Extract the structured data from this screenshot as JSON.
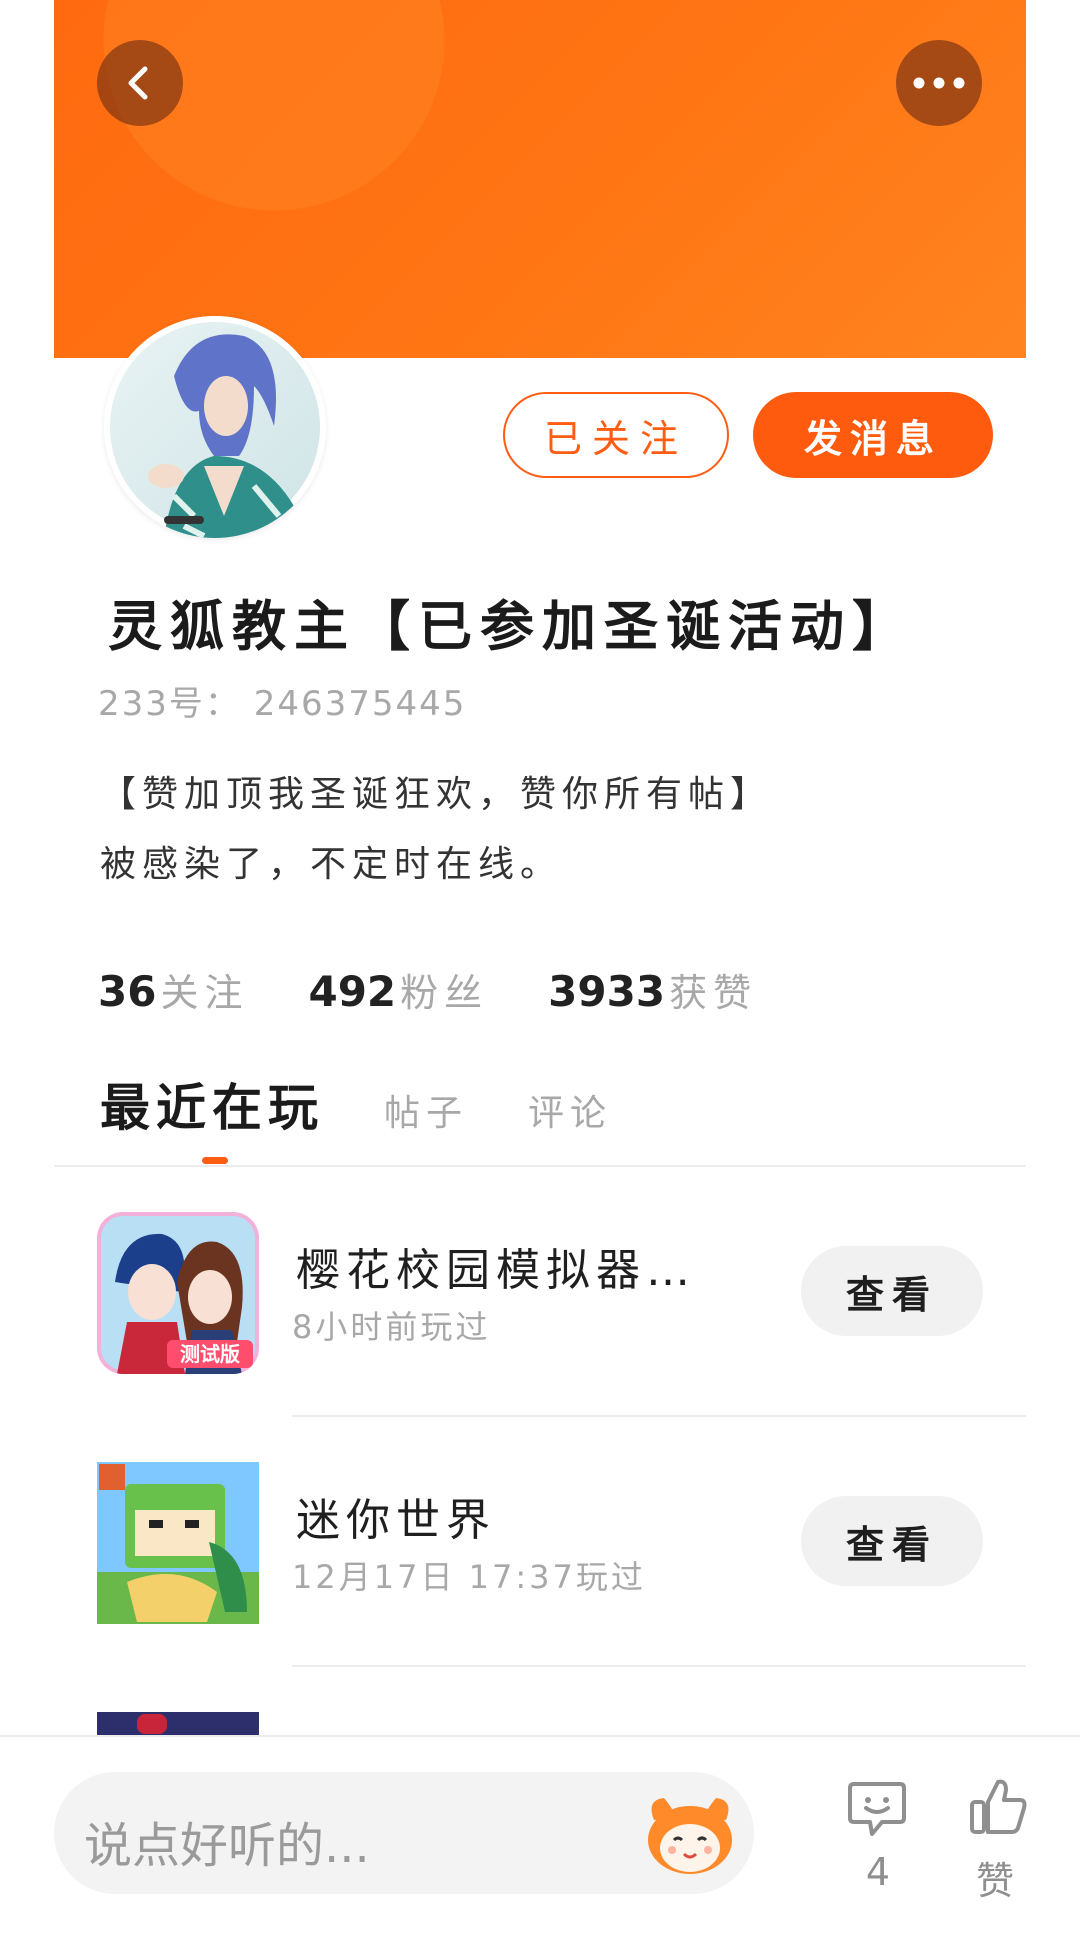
{
  "header": {
    "back_icon": "chevron-left-icon",
    "more_icon": "more-dots-icon",
    "accent": "#ff6a10"
  },
  "profile": {
    "follow_label": "已关注",
    "message_label": "发消息",
    "name": "灵狐教主【已参加圣诞活动】",
    "uid": "233号： 246375445",
    "bio": [
      "【赞加顶我圣诞狂欢，赞你所有帖】",
      "被感染了，不定时在线。"
    ]
  },
  "stats": [
    {
      "num": "36",
      "label": "关注"
    },
    {
      "num": "492",
      "label": "粉丝"
    },
    {
      "num": "3933",
      "label": "获赞"
    }
  ],
  "tabs": [
    {
      "label": "最近在玩",
      "active": true
    },
    {
      "label": "帖子",
      "active": false
    },
    {
      "label": "评论",
      "active": false
    }
  ],
  "games": [
    {
      "title": "樱花校园模拟器…",
      "sub": "8小时前玩过",
      "button": "查看",
      "badge": "测试版"
    },
    {
      "title": "迷你世界",
      "sub": "12月17日  17:37玩过",
      "button": "查看"
    }
  ],
  "bottom": {
    "placeholder": "说点好听的...",
    "comment_count": "4",
    "like_label": "赞"
  }
}
